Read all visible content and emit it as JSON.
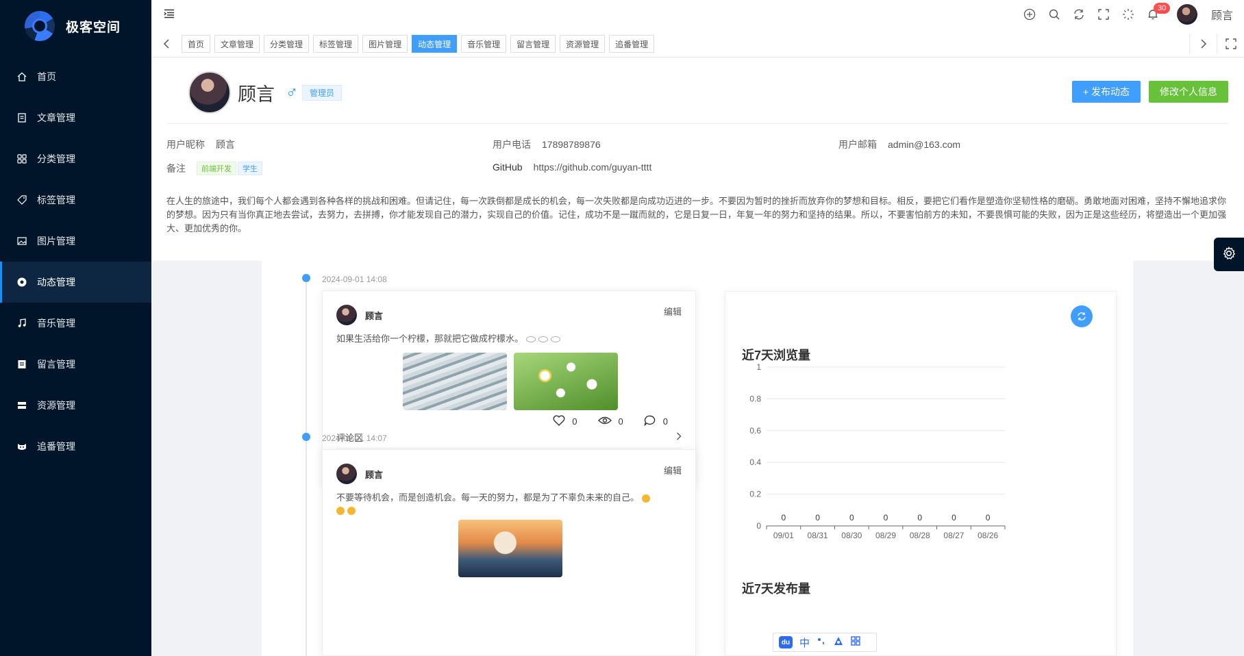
{
  "sidebar": {
    "logo_text": "极客空间",
    "items": [
      {
        "label": "首页",
        "icon": "home-icon"
      },
      {
        "label": "文章管理",
        "icon": "article-icon"
      },
      {
        "label": "分类管理",
        "icon": "grid-icon"
      },
      {
        "label": "标签管理",
        "icon": "tag-icon"
      },
      {
        "label": "图片管理",
        "icon": "image-icon"
      },
      {
        "label": "动态管理",
        "icon": "moments-icon",
        "active": true
      },
      {
        "label": "音乐管理",
        "icon": "music-icon"
      },
      {
        "label": "留言管理",
        "icon": "message-icon"
      },
      {
        "label": "资源管理",
        "icon": "resource-icon"
      },
      {
        "label": "追番管理",
        "icon": "anime-icon"
      }
    ]
  },
  "header": {
    "notification_count": "30",
    "username": "顾言",
    "tabs": [
      {
        "label": "首页"
      },
      {
        "label": "文章管理"
      },
      {
        "label": "分类管理"
      },
      {
        "label": "标签管理"
      },
      {
        "label": "图片管理"
      },
      {
        "label": "动态管理",
        "active": true
      },
      {
        "label": "音乐管理"
      },
      {
        "label": "留言管理"
      },
      {
        "label": "资源管理"
      },
      {
        "label": "追番管理"
      }
    ]
  },
  "profile": {
    "name": "顾言",
    "gender_symbol": "♂",
    "role": "管理员",
    "publish_button": "+ 发布动态",
    "edit_button": "修改个人信息",
    "nickname_label": "用户昵称",
    "nickname": "顾言",
    "phone_label": "用户电话",
    "phone": "17898789876",
    "email_label": "用户邮箱",
    "email": "admin@163.com",
    "remark_label": "备注",
    "remark_tags": [
      "前端开发",
      "学生"
    ],
    "github_label": "GitHub",
    "github": "https://github.com/guyan-tttt",
    "bio": "在人生的旅途中，我们每个人都会遇到各种各样的挑战和困难。但请记住，每一次跌倒都是成长的机会，每一次失败都是向成功迈进的一步。不要因为暂时的挫折而放弃你的梦想和目标。相反，要把它们看作是塑造你坚韧性格的磨砺。勇敢地面对困难，坚持不懈地追求你的梦想。因为只有当你真正地去尝试，去努力，去拼搏，你才能发现自己的潜力，实现自己的价值。记住，成功不是一蹴而就的，它是日复一日，年复一年的努力和坚持的结果。所以，不要害怕前方的未知，不要畏惧可能的失败，因为正是这些经历，将塑造出一个更加强大、更加优秀的你。"
  },
  "posts": [
    {
      "time": "2024-09-01 14:08",
      "author": "顾言",
      "edit_label": "编辑",
      "text": "如果生活给你一个柠檬，那就把它做成柠檬水。",
      "likes": "0",
      "views": "0",
      "comments": "0",
      "comment_label": "评论区"
    },
    {
      "time": "2024-09-01 14:07",
      "author": "顾言",
      "edit_label": "编辑",
      "text": "不要等待机会，而是创造机会。每一天的努力，都是为了不辜负未来的自己。"
    }
  ],
  "chart_data": [
    {
      "type": "bar",
      "title": "近7天浏览量",
      "categories": [
        "09/01",
        "08/31",
        "08/30",
        "08/29",
        "08/28",
        "08/27",
        "08/26"
      ],
      "values": [
        0,
        0,
        0,
        0,
        0,
        0,
        0
      ],
      "yticks": [
        "0",
        "0.2",
        "0.4",
        "0.6",
        "0.8",
        "1"
      ],
      "ylim": [
        0,
        1
      ],
      "grid": true
    },
    {
      "type": "bar",
      "title": "近7天发布量"
    }
  ],
  "ime": {
    "badge": "du",
    "lang": "中"
  }
}
